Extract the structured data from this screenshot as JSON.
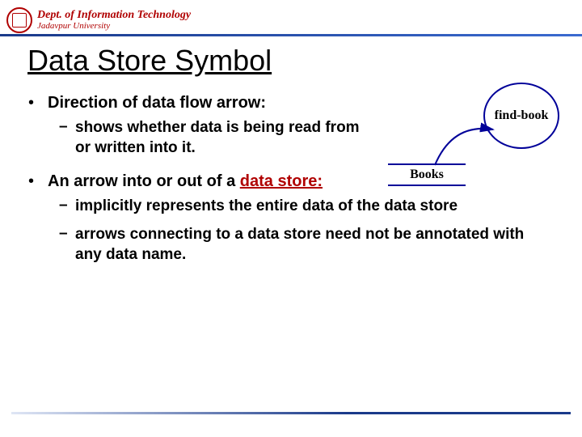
{
  "header": {
    "dept_line1": "Dept. of Information Technology",
    "dept_line2": "Jadavpur University"
  },
  "title": "Data Store Symbol",
  "bullets": {
    "b1": "Direction of data flow arrow:",
    "b1_sub1": "shows whether data is being read from or written into it.",
    "b2_pre": "An arrow  into or out of a ",
    "b2_link": "data store:",
    "b2_sub1": "implicitly represents the entire data of the data store",
    "b2_sub2": "arrows connecting to a data store need not be annotated with any data name."
  },
  "diagram": {
    "process_label": "find-book",
    "datastore_label": "Books"
  }
}
